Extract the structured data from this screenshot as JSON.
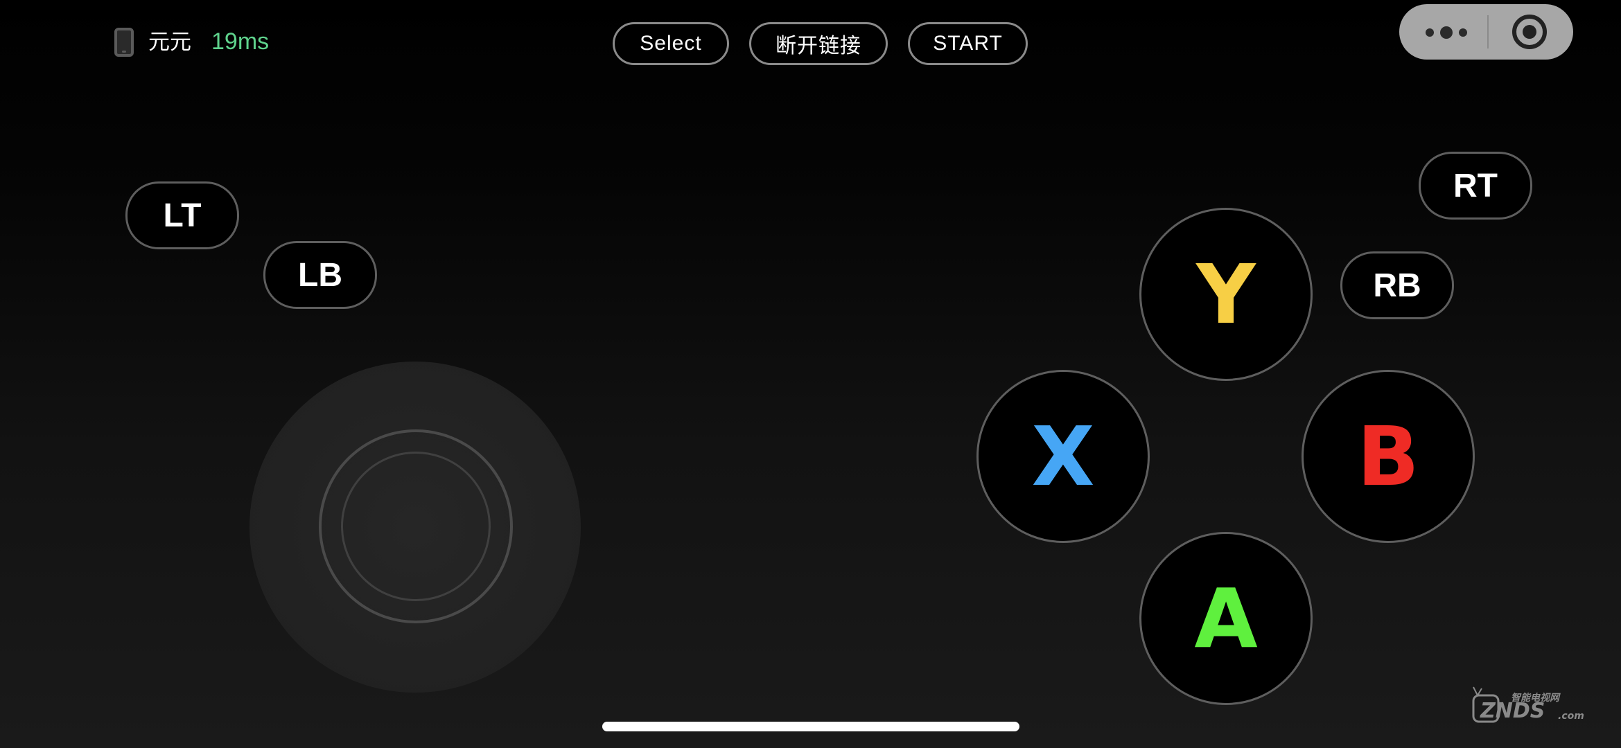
{
  "status": {
    "device_icon": "phone-icon",
    "device_name": "元元",
    "latency": "19ms"
  },
  "top_buttons": {
    "select_label": "Select",
    "disconnect_label": "断开链接",
    "start_label": "START"
  },
  "capsule": {
    "more_icon": "more-icon",
    "close_icon": "target-icon"
  },
  "shoulder": {
    "lt": "LT",
    "lb": "LB",
    "rt": "RT",
    "rb": "RB"
  },
  "face": {
    "y": {
      "label": "Y",
      "color": "#f7cf45"
    },
    "x": {
      "label": "X",
      "color": "#46a6f5"
    },
    "b": {
      "label": "B",
      "color": "#ef2b25"
    },
    "a": {
      "label": "A",
      "color": "#5ff03e"
    }
  },
  "watermark": {
    "logo": "ZNDS",
    "suffix": ".com",
    "caption": "智能电视网"
  },
  "colors": {
    "latency": "#5fd38d",
    "background": "#000000",
    "capsule": "#a7a7a7"
  }
}
